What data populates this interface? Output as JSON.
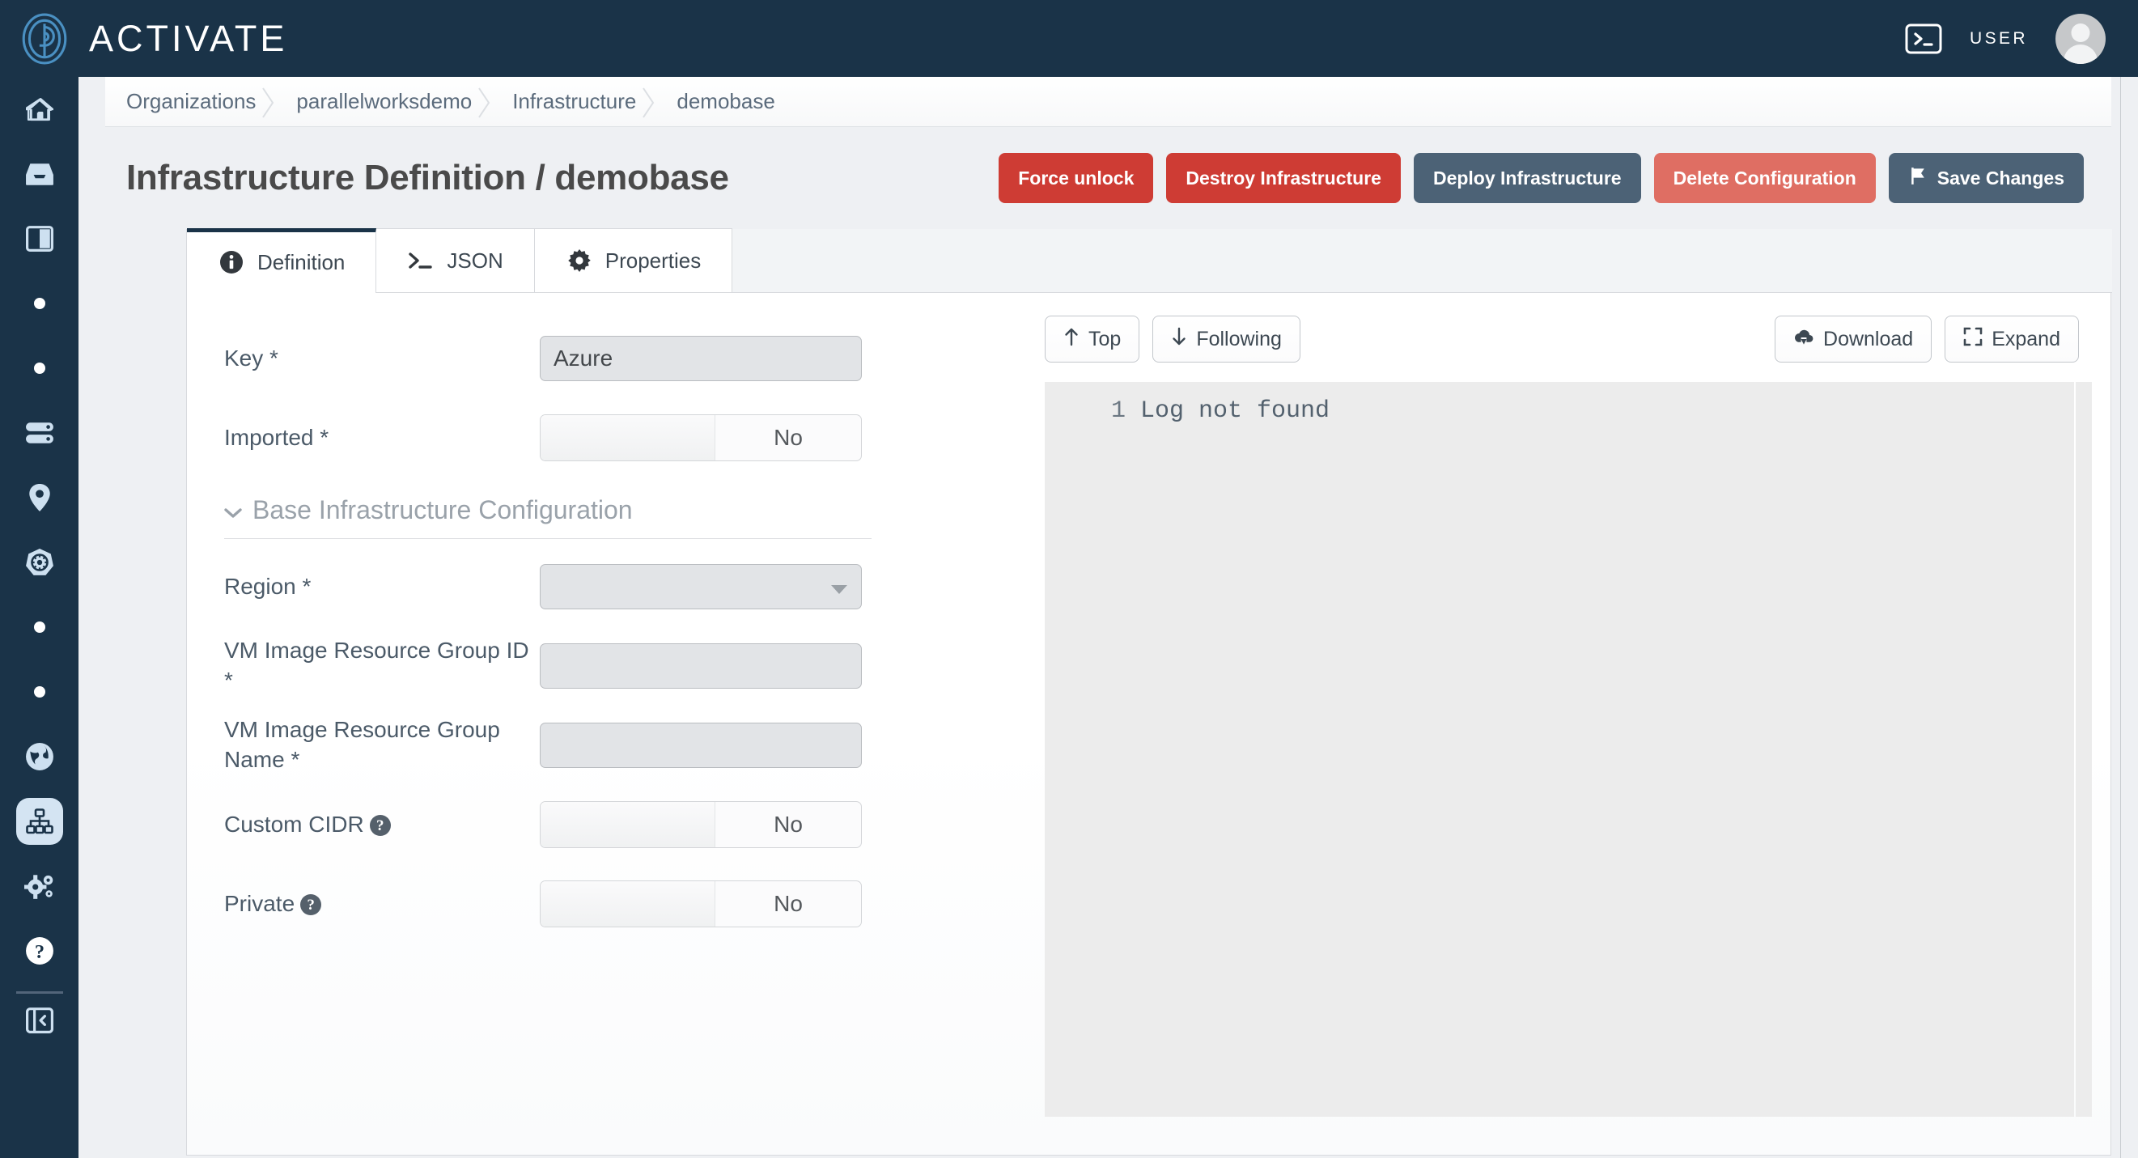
{
  "app": {
    "brand": "ACTIVATE",
    "logo_icon": "fingerprint-p-logo",
    "accent_navy": "#1a3348",
    "accent_blue": "#4a90c2"
  },
  "topbar": {
    "terminal_icon": "terminal-icon",
    "user_label": "USER",
    "avatar_icon": "user-avatar"
  },
  "sidebar": {
    "items": [
      {
        "name": "home",
        "icon": "home-icon"
      },
      {
        "name": "inbox",
        "icon": "inbox-tray-icon"
      },
      {
        "name": "panels",
        "icon": "columns-panel-icon"
      },
      {
        "name": "dot-1",
        "icon": "dot-icon"
      },
      {
        "name": "dot-2",
        "icon": "dot-icon"
      },
      {
        "name": "storage",
        "icon": "server-stack-icon"
      },
      {
        "name": "locations",
        "icon": "map-pin-icon"
      },
      {
        "name": "kubernetes",
        "icon": "kubernetes-helm-icon"
      },
      {
        "name": "dot-3",
        "icon": "dot-icon"
      },
      {
        "name": "dot-4",
        "icon": "dot-icon"
      },
      {
        "name": "globe",
        "icon": "globe-icon"
      },
      {
        "name": "infrastructure",
        "icon": "sitemap-icon",
        "active": true
      },
      {
        "name": "settings",
        "icon": "cogs-icon"
      },
      {
        "name": "help",
        "icon": "question-circle-icon"
      }
    ],
    "collapse_icon": "collapse-sidebar-icon"
  },
  "breadcrumb": {
    "items": [
      "Organizations",
      "parallelworksdemo",
      "Infrastructure",
      "demobase"
    ]
  },
  "header": {
    "title": "Infrastructure Definition / demobase",
    "actions": [
      {
        "label": "Force unlock",
        "style": "danger",
        "icon": null
      },
      {
        "label": "Destroy Infrastructure",
        "style": "danger",
        "icon": null
      },
      {
        "label": "Deploy Infrastructure",
        "style": "slate",
        "icon": null
      },
      {
        "label": "Delete Configuration",
        "style": "salmon",
        "icon": null
      },
      {
        "label": "Save Changes",
        "style": "slate",
        "icon": "flag-icon"
      }
    ]
  },
  "tabs": [
    {
      "label": "Definition",
      "icon": "info-circle-icon",
      "active": true
    },
    {
      "label": "JSON",
      "icon": "terminal-icon",
      "active": false
    },
    {
      "label": "Properties",
      "icon": "gear-icon",
      "active": false
    }
  ],
  "form": {
    "fields": [
      {
        "label": "Key",
        "required": true,
        "type": "text",
        "value": "Azure",
        "placeholder": "",
        "help": false,
        "disabled": true
      },
      {
        "label": "Imported",
        "required": true,
        "type": "toggle",
        "value": "No",
        "help": false
      }
    ],
    "section": {
      "title": "Base Infrastructure Configuration",
      "chevron_icon": "chevron-down-icon",
      "expanded": true,
      "fields": [
        {
          "label": "Region",
          "required": true,
          "type": "select",
          "value": "",
          "help": false
        },
        {
          "label": "VM Image Resource Group ID",
          "required": true,
          "type": "text",
          "value": "",
          "placeholder": "",
          "help": false
        },
        {
          "label": "VM Image Resource Group Name",
          "required": true,
          "type": "text",
          "value": "",
          "placeholder": "",
          "help": false
        },
        {
          "label": "Custom CIDR",
          "required": false,
          "type": "toggle",
          "value": "No",
          "help": true
        },
        {
          "label": "Private",
          "required": false,
          "type": "toggle",
          "value": "No",
          "help": true
        }
      ]
    }
  },
  "log_panel": {
    "buttons_left": [
      {
        "label": "Top",
        "icon": "arrow-up-icon"
      },
      {
        "label": "Following",
        "icon": "arrow-down-icon"
      }
    ],
    "buttons_right": [
      {
        "label": "Download",
        "icon": "cloud-download-icon"
      },
      {
        "label": "Expand",
        "icon": "expand-icon"
      }
    ],
    "lines": [
      {
        "number": "1",
        "text": "Log not found"
      }
    ]
  }
}
